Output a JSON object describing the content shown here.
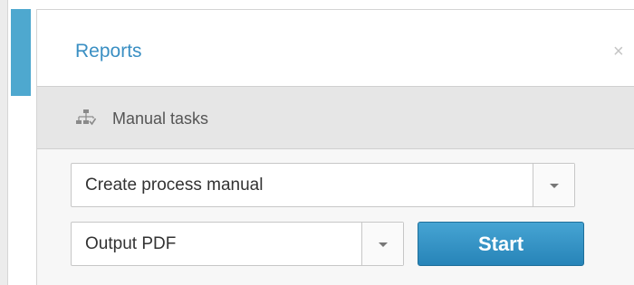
{
  "panel": {
    "title": "Reports",
    "close_icon": "close-icon",
    "close_glyph": "×"
  },
  "section": {
    "label": "Manual tasks",
    "icon": "tree-structure-icon"
  },
  "process_select": {
    "value": "Create process manual"
  },
  "output_select": {
    "value": "Output PDF"
  },
  "start_button": {
    "label": "Start"
  },
  "colors": {
    "accent": "#4ea8cf",
    "title": "#3a8fc3",
    "button": "#2784b8"
  }
}
